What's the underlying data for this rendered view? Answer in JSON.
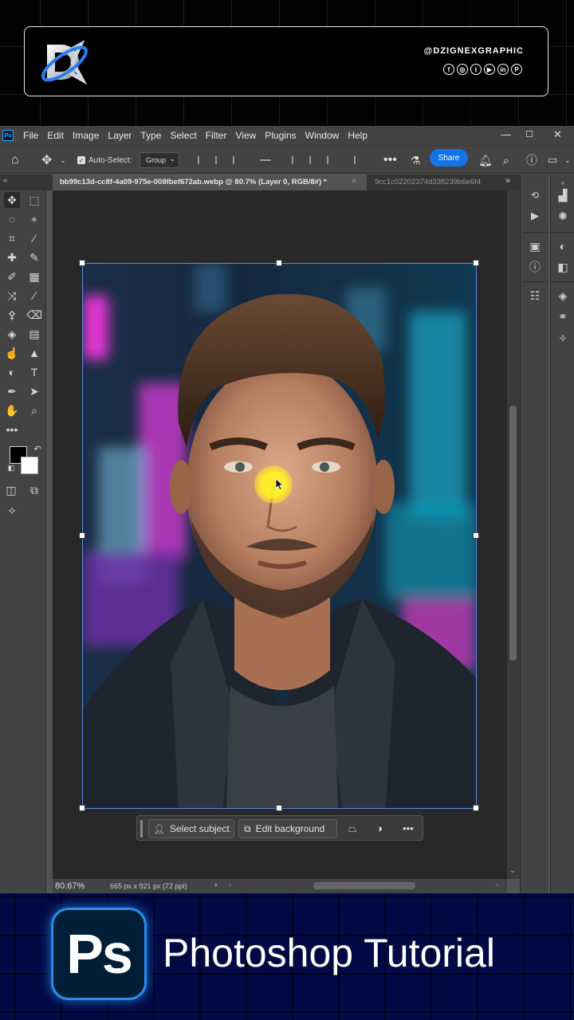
{
  "banner": {
    "handle": "@DZIGNEXGRAPHIC",
    "socials": [
      "f",
      "◎",
      "t",
      "▶",
      "in",
      "P"
    ]
  },
  "menu": {
    "items": [
      "File",
      "Edit",
      "Image",
      "Layer",
      "Type",
      "Select",
      "Filter",
      "View",
      "Plugins",
      "Window",
      "Help"
    ]
  },
  "options": {
    "auto_select_label": "Auto-Select:",
    "group_value": "Group",
    "share_label": "Share"
  },
  "tabs": {
    "active": "bb99c13d-cc8f-4a09-975e-008fbef672ab.webp @ 80.7% (Layer 0, RGB/8#) *",
    "close": "×",
    "second": "9cc1c02202374d338239b6e6f4"
  },
  "context_bar": {
    "select_subject": "Select subject",
    "edit_background": "Edit background"
  },
  "status": {
    "zoom": "80.67%",
    "doc_size": "665 px x 921 px (72 ppi)"
  },
  "bottom": {
    "badge": "Ps",
    "title": "Photoshop Tutorial"
  },
  "colors": {
    "accent": "#1473e6",
    "ps_blue": "#31a8ff",
    "foreground": "#000000",
    "background": "#ffffff"
  }
}
